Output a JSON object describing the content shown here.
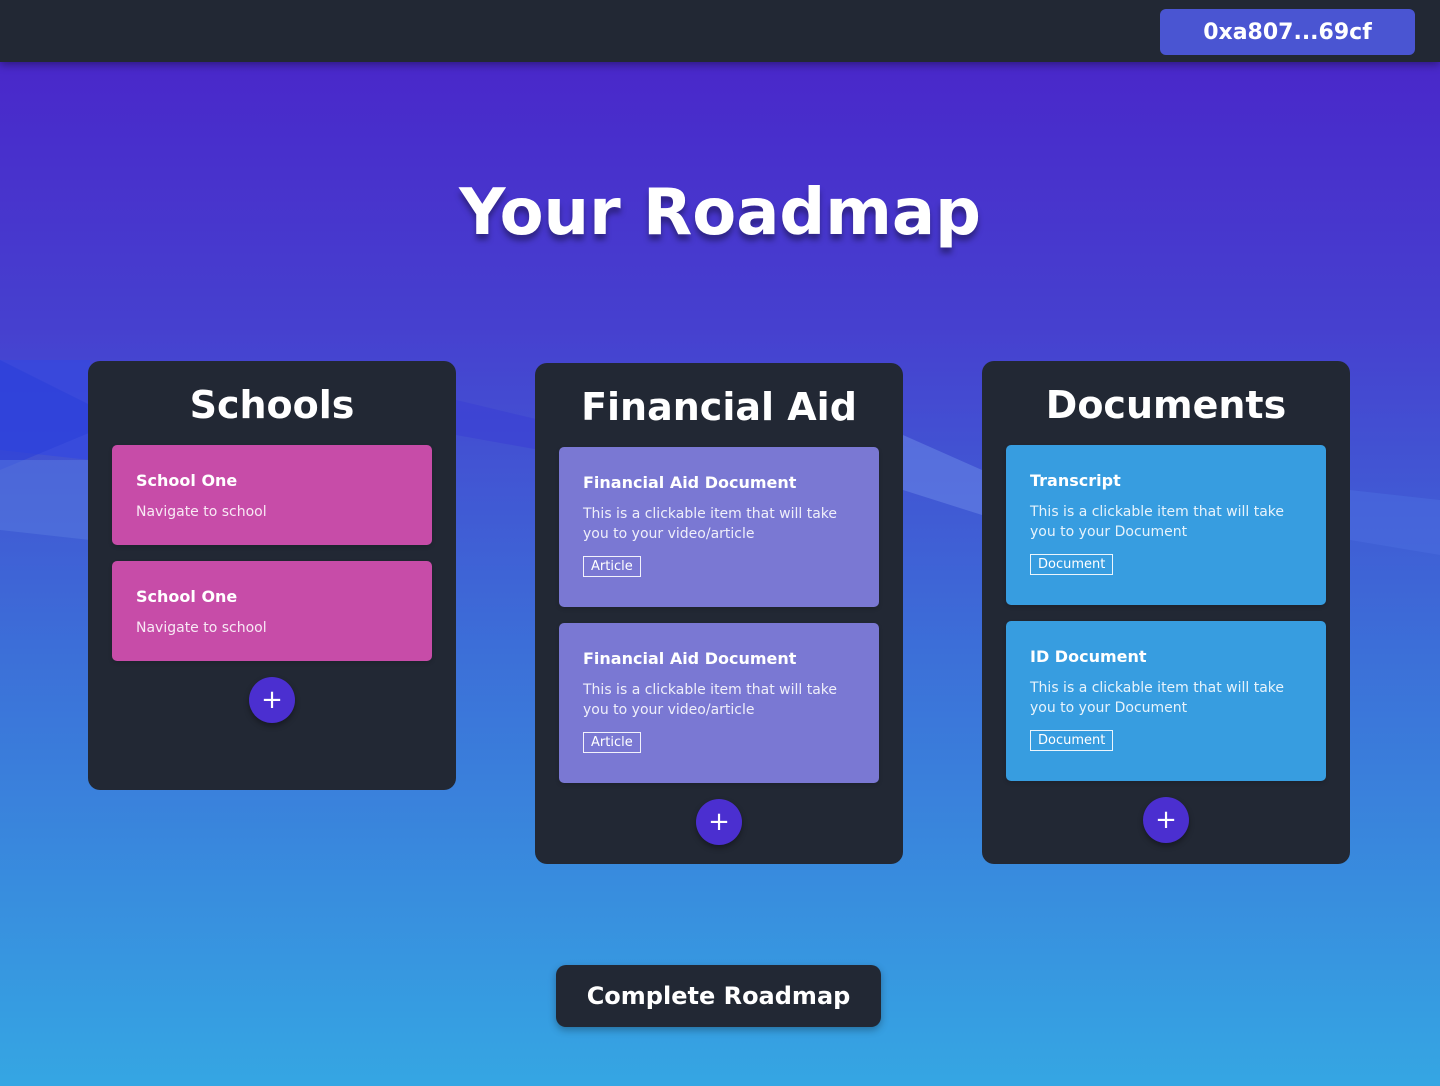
{
  "header": {
    "wallet_address": "0xa807...69cf"
  },
  "page_title": "Your Roadmap",
  "columns": [
    {
      "title": "Schools",
      "cards": [
        {
          "title": "School One",
          "description": "Navigate to school"
        },
        {
          "title": "School One",
          "description": "Navigate to school"
        }
      ],
      "add_label": "+"
    },
    {
      "title": "Financial Aid",
      "cards": [
        {
          "title": "Financial Aid Document",
          "description": "This is a clickable item that will take you to your video/article",
          "tag": "Article"
        },
        {
          "title": "Financial Aid Document",
          "description": "This is a clickable item that will take you to your video/article",
          "tag": "Article"
        }
      ],
      "add_label": "+"
    },
    {
      "title": "Documents",
      "cards": [
        {
          "title": "Transcript",
          "description": "This is a clickable item that will take you to your Document",
          "tag": "Document"
        },
        {
          "title": "ID Document",
          "description": "This is a clickable item that will take you to your Document",
          "tag": "Document"
        }
      ],
      "add_label": "+"
    }
  ],
  "complete_button": "Complete Roadmap",
  "colors": {
    "panel": "#222834",
    "school_card": "#c74ca8",
    "aid_card": "#7a78d3",
    "doc_card": "#379de0",
    "accent": "#4b2fd0"
  }
}
